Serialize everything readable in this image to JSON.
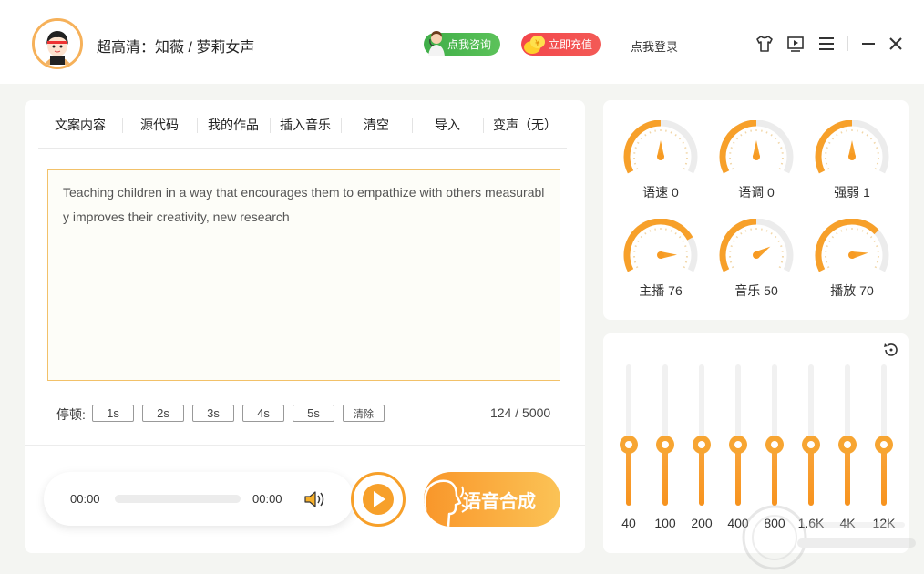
{
  "header": {
    "voice_title": "超高清：知薇 / 萝莉女声",
    "consult_label": "点我咨询",
    "recharge_label": "立即充值",
    "login_label": "点我登录"
  },
  "tabs": [
    {
      "label": "文案内容"
    },
    {
      "label": "源代码"
    },
    {
      "label": "我的作品"
    },
    {
      "label": "插入音乐"
    },
    {
      "label": "清空"
    },
    {
      "label": "导入"
    },
    {
      "label": "变声（无）"
    }
  ],
  "editor": {
    "text": "Teaching children in a way that encourages them to empathize with others measurably improves their creativity, new research"
  },
  "pause": {
    "label": "停顿:",
    "options": [
      "1s",
      "2s",
      "3s",
      "4s",
      "5s"
    ],
    "clear_label": "清除"
  },
  "char_count": "124 / 5000",
  "player": {
    "current_time": "00:00",
    "total_time": "00:00",
    "progress": 0
  },
  "synth_button": "语音合成",
  "gauges": [
    {
      "label": "语速 0",
      "value": 0
    },
    {
      "label": "语调 0",
      "value": 0
    },
    {
      "label": "强弱 1",
      "value": 1
    },
    {
      "label": "主播 76",
      "value": 76
    },
    {
      "label": "音乐 50",
      "value": 50
    },
    {
      "label": "播放 70",
      "value": 70
    }
  ],
  "equalizer": [
    {
      "label": "40",
      "level": 0.5
    },
    {
      "label": "100",
      "level": 0.5
    },
    {
      "label": "200",
      "level": 0.5
    },
    {
      "label": "400",
      "level": 0.5
    },
    {
      "label": "800",
      "level": 0.5
    },
    {
      "label": "1.6K",
      "level": 0.5
    },
    {
      "label": "4K",
      "level": 0.5
    },
    {
      "label": "12K",
      "level": 0.5
    }
  ],
  "colors": {
    "accent": "#f7a02a",
    "consult": "#3fae48",
    "recharge": "#f3464b"
  }
}
